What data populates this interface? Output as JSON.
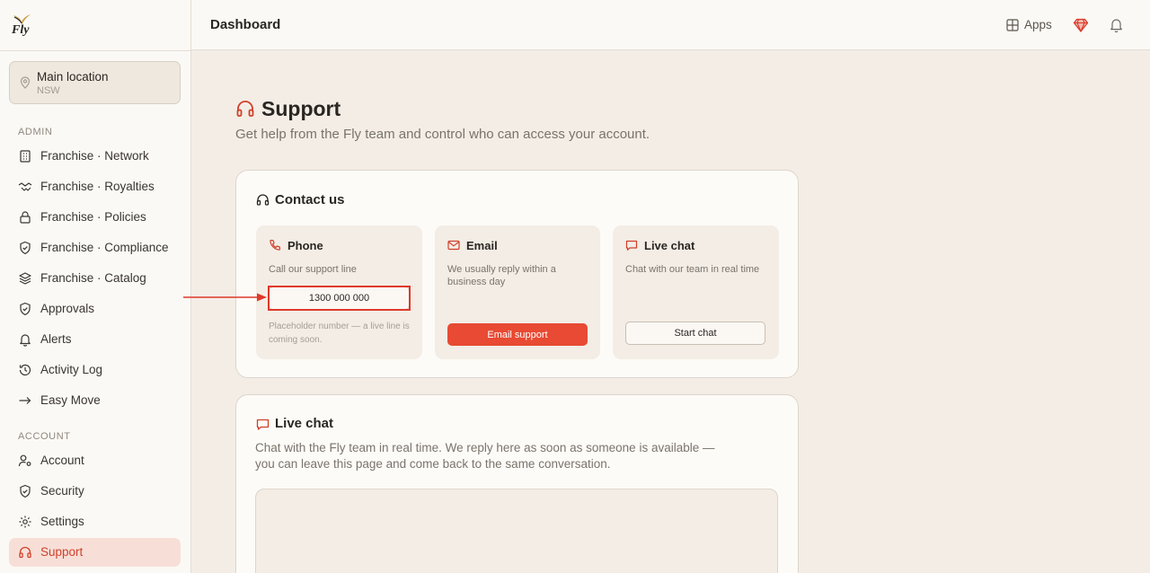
{
  "app": {
    "logo_text": "Fly",
    "brand_color": "#e84a33"
  },
  "sidebar": {
    "location": {
      "name": "Main location",
      "sub": "NSW"
    },
    "admin_label": "ADMIN",
    "admin_items": [
      {
        "label": "Franchise · Network",
        "icon": "building-icon"
      },
      {
        "label": "Franchise · Royalties",
        "icon": "handshake-icon"
      },
      {
        "label": "Franchise · Policies",
        "icon": "lock-icon"
      },
      {
        "label": "Franchise · Compliance",
        "icon": "shield-check-icon"
      },
      {
        "label": "Franchise · Catalog",
        "icon": "layers-icon"
      },
      {
        "label": "Approvals",
        "icon": "shield-check-icon"
      },
      {
        "label": "Alerts",
        "icon": "bell-icon"
      },
      {
        "label": "Activity Log",
        "icon": "history-icon"
      },
      {
        "label": "Easy Move",
        "icon": "arrow-right-icon"
      }
    ],
    "account_label": "ACCOUNT",
    "account_items": [
      {
        "label": "Account",
        "icon": "user-cog-icon"
      },
      {
        "label": "Security",
        "icon": "shield-check-icon"
      },
      {
        "label": "Settings",
        "icon": "gear-icon"
      },
      {
        "label": "Support",
        "icon": "headset-icon",
        "active": true
      }
    ]
  },
  "header": {
    "title": "Dashboard",
    "apps_label": "Apps"
  },
  "page": {
    "title": "Support",
    "subtitle": "Get help from the Fly team and control who can access your account."
  },
  "contact": {
    "title": "Contact us",
    "phone": {
      "title": "Phone",
      "desc": "Call our support line",
      "number": "1300 000 000",
      "note": "Placeholder number — a live line is coming soon."
    },
    "email": {
      "title": "Email",
      "desc": "We usually reply within a business day",
      "button": "Email support"
    },
    "livechat": {
      "title": "Live chat",
      "desc": "Chat with our team in real time",
      "button": "Start chat"
    }
  },
  "chat": {
    "title": "Live chat",
    "desc": "Chat with the Fly team in real time. We reply here as soon as someone is available — you can leave this page and come back to the same conversation."
  }
}
